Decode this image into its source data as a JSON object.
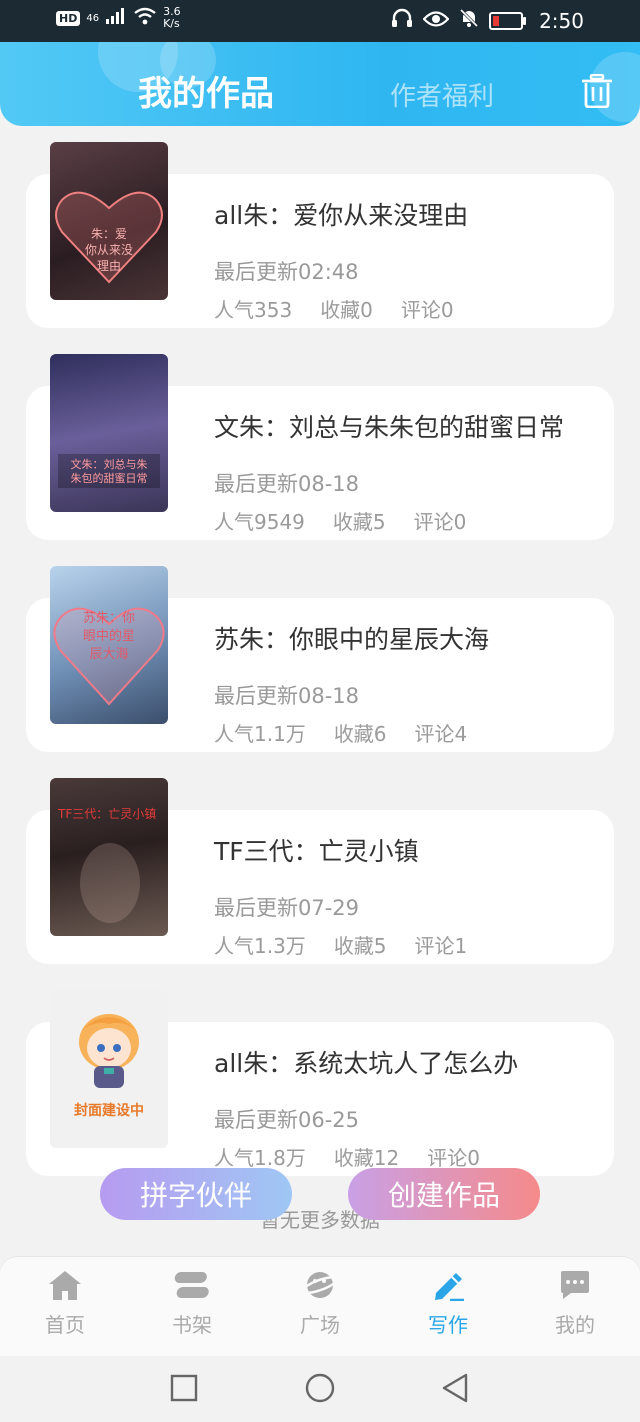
{
  "status_bar": {
    "hd": "HD",
    "network": "46",
    "speed_value": "3.6",
    "speed_unit": "K/s",
    "time": "2:50"
  },
  "header": {
    "tab_active": "我的作品",
    "tab_inactive": "作者福利"
  },
  "works": [
    {
      "title": "all朱：爱你从来没理由",
      "updated": "最后更新02:48",
      "popularity": "人气353",
      "favorites": "收藏0",
      "comments": "评论0",
      "cover_text": "all朱：爱你从来没理由",
      "cover_color": "#3a2a2e"
    },
    {
      "title": "文朱：刘总与朱朱包的甜蜜日常",
      "updated": "最后更新08-18",
      "popularity": "人气9549",
      "favorites": "收藏5",
      "comments": "评论0",
      "cover_text": "文朱：刘总与朱朱包的甜蜜日常",
      "cover_color": "#3b3a63"
    },
    {
      "title": "苏朱：你眼中的星辰大海",
      "updated": "最后更新08-18",
      "popularity": "人气1.1万",
      "favorites": "收藏6",
      "comments": "评论4",
      "cover_text": "苏朱：你眼中的星辰大海",
      "cover_color": "#7a9cc0"
    },
    {
      "title": "TF三代：亡灵小镇",
      "updated": "最后更新07-29",
      "popularity": "人气1.3万",
      "favorites": "收藏5",
      "comments": "评论1",
      "cover_text": "TF三代：亡灵小镇",
      "cover_color": "#2b2121"
    },
    {
      "title": "all朱：系统太坑人了怎么办",
      "updated": "最后更新06-25",
      "popularity": "人气1.8万",
      "favorites": "收藏12",
      "comments": "评论0",
      "cover_text": "封面建设中",
      "cover_color": "#f1f1f1"
    }
  ],
  "footer_note": "暂无更多数据",
  "actions": {
    "partner": "拼字伙伴",
    "create": "创建作品"
  },
  "tabbar": [
    {
      "label": "首页",
      "icon": "home-icon"
    },
    {
      "label": "书架",
      "icon": "bookshelf-icon"
    },
    {
      "label": "广场",
      "icon": "planet-icon"
    },
    {
      "label": "写作",
      "icon": "pen-icon",
      "active": true
    },
    {
      "label": "我的",
      "icon": "chat-bubble-icon"
    }
  ],
  "colors": {
    "header": "#2fb6f1",
    "active_tab": "#2aa6e8"
  }
}
